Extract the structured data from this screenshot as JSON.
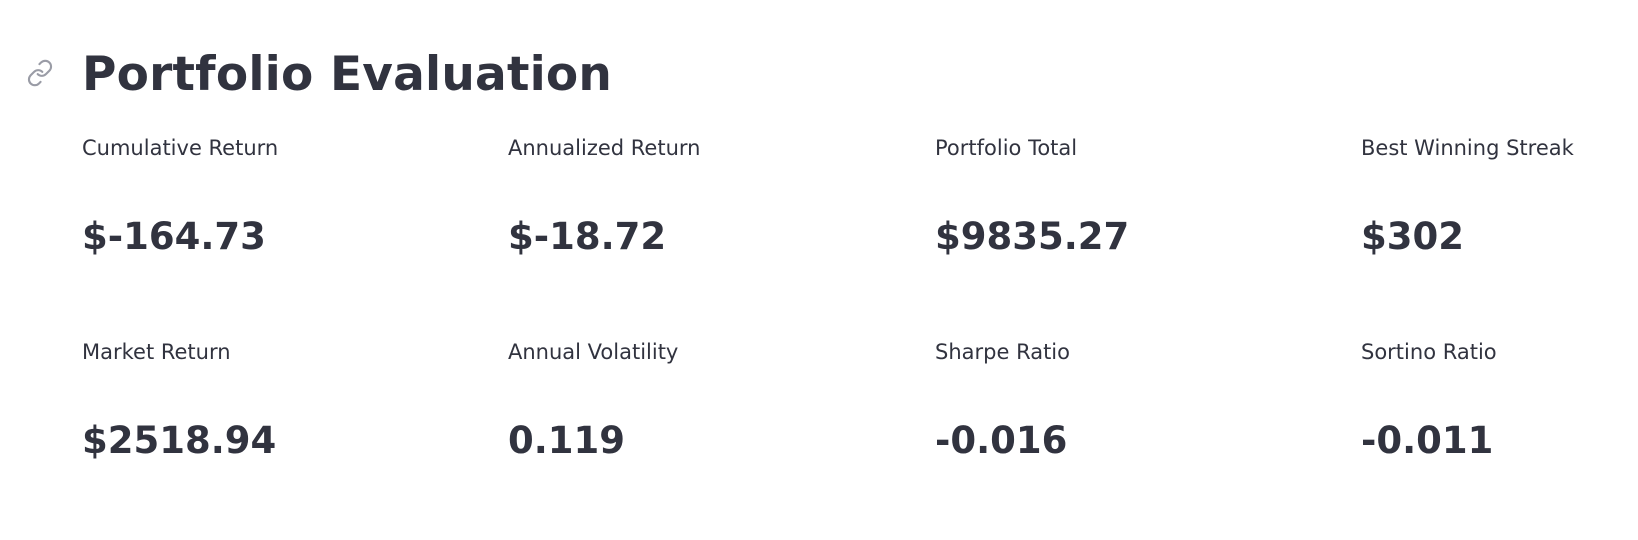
{
  "header": {
    "title": "Portfolio Evaluation",
    "anchor_icon": "link-icon"
  },
  "metrics": {
    "row1": [
      {
        "label": "Cumulative Return",
        "value": "$-164.73"
      },
      {
        "label": "Annualized Return",
        "value": "$-18.72"
      },
      {
        "label": "Portfolio Total",
        "value": "$9835.27"
      },
      {
        "label": "Best Winning Streak",
        "value": "$302"
      }
    ],
    "row2": [
      {
        "label": "Market Return",
        "value": "$2518.94"
      },
      {
        "label": "Annual Volatility",
        "value": "0.119"
      },
      {
        "label": "Sharpe Ratio",
        "value": "-0.016"
      },
      {
        "label": "Sortino Ratio",
        "value": "-0.011"
      }
    ]
  },
  "colors": {
    "text": "#31333f",
    "icon": "#9a9ca6",
    "background": "#ffffff"
  }
}
